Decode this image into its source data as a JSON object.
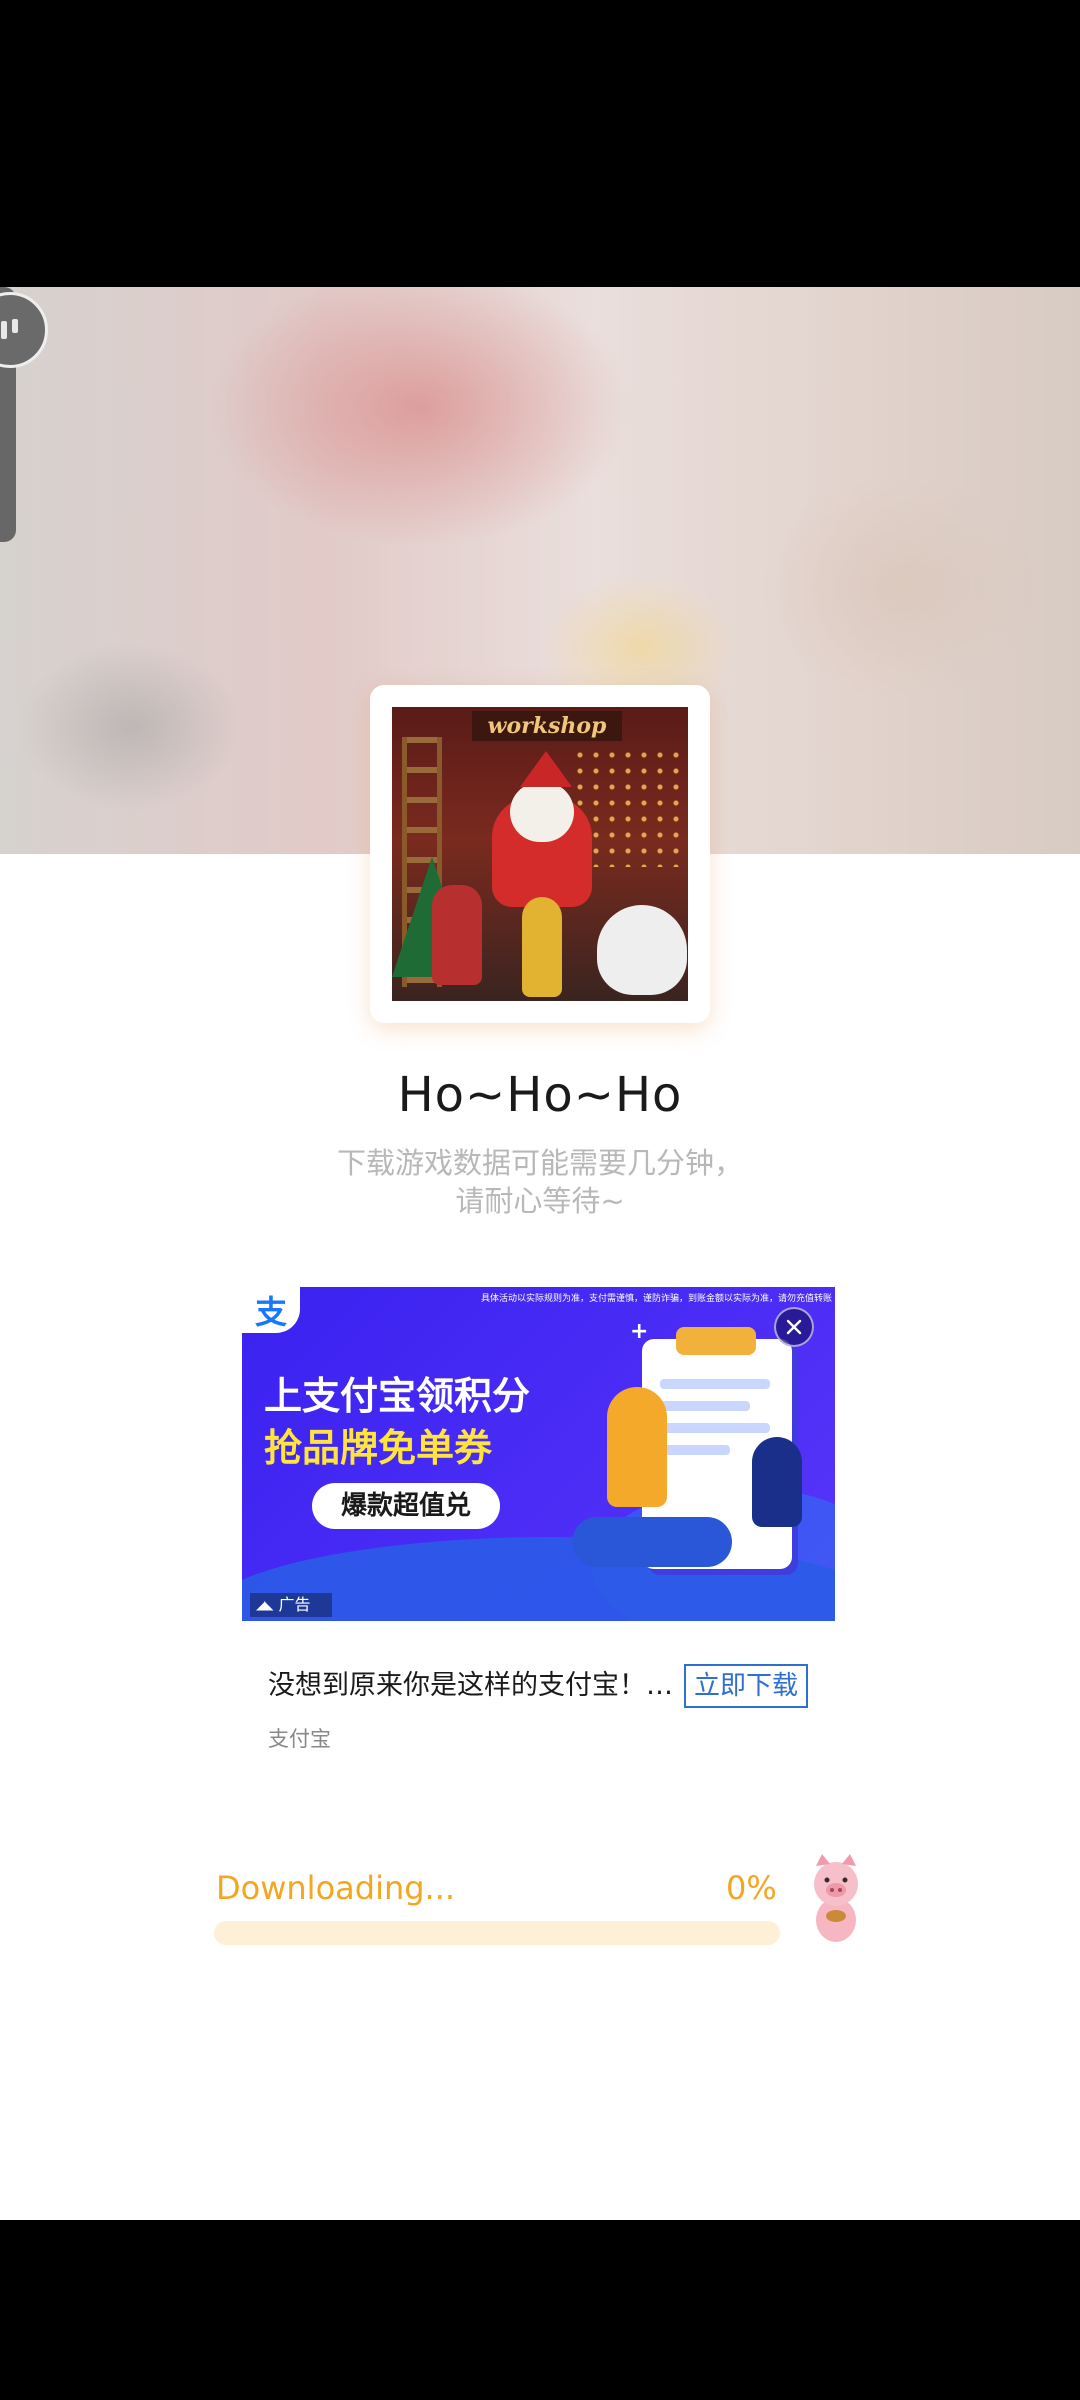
{
  "game": {
    "title": "Ho~Ho~Ho",
    "subtitle_line1": "下载游戏数据可能需要几分钟，",
    "subtitle_line2": "请耐心等待~",
    "icon_sign": "workshop"
  },
  "ad": {
    "fine_print": "具体活动以实际规则为准，支付需谨慎，谨防诈骗，到账金额以实际为准，请勿充值转账",
    "headline_line1": "上支付宝领积分",
    "headline_line2": "抢品牌免单券",
    "pill_label": "爆款超值兑",
    "tag_label": "广告",
    "logo_char": "支",
    "caption": "没想到原来你是这样的支付宝！…",
    "download_button": "立即下载",
    "brand": "支付宝",
    "accent_color": "#2e6fd1"
  },
  "download": {
    "label": "Downloading...",
    "percent_text": "0%",
    "progress": 0,
    "color": "#f3a61f"
  }
}
